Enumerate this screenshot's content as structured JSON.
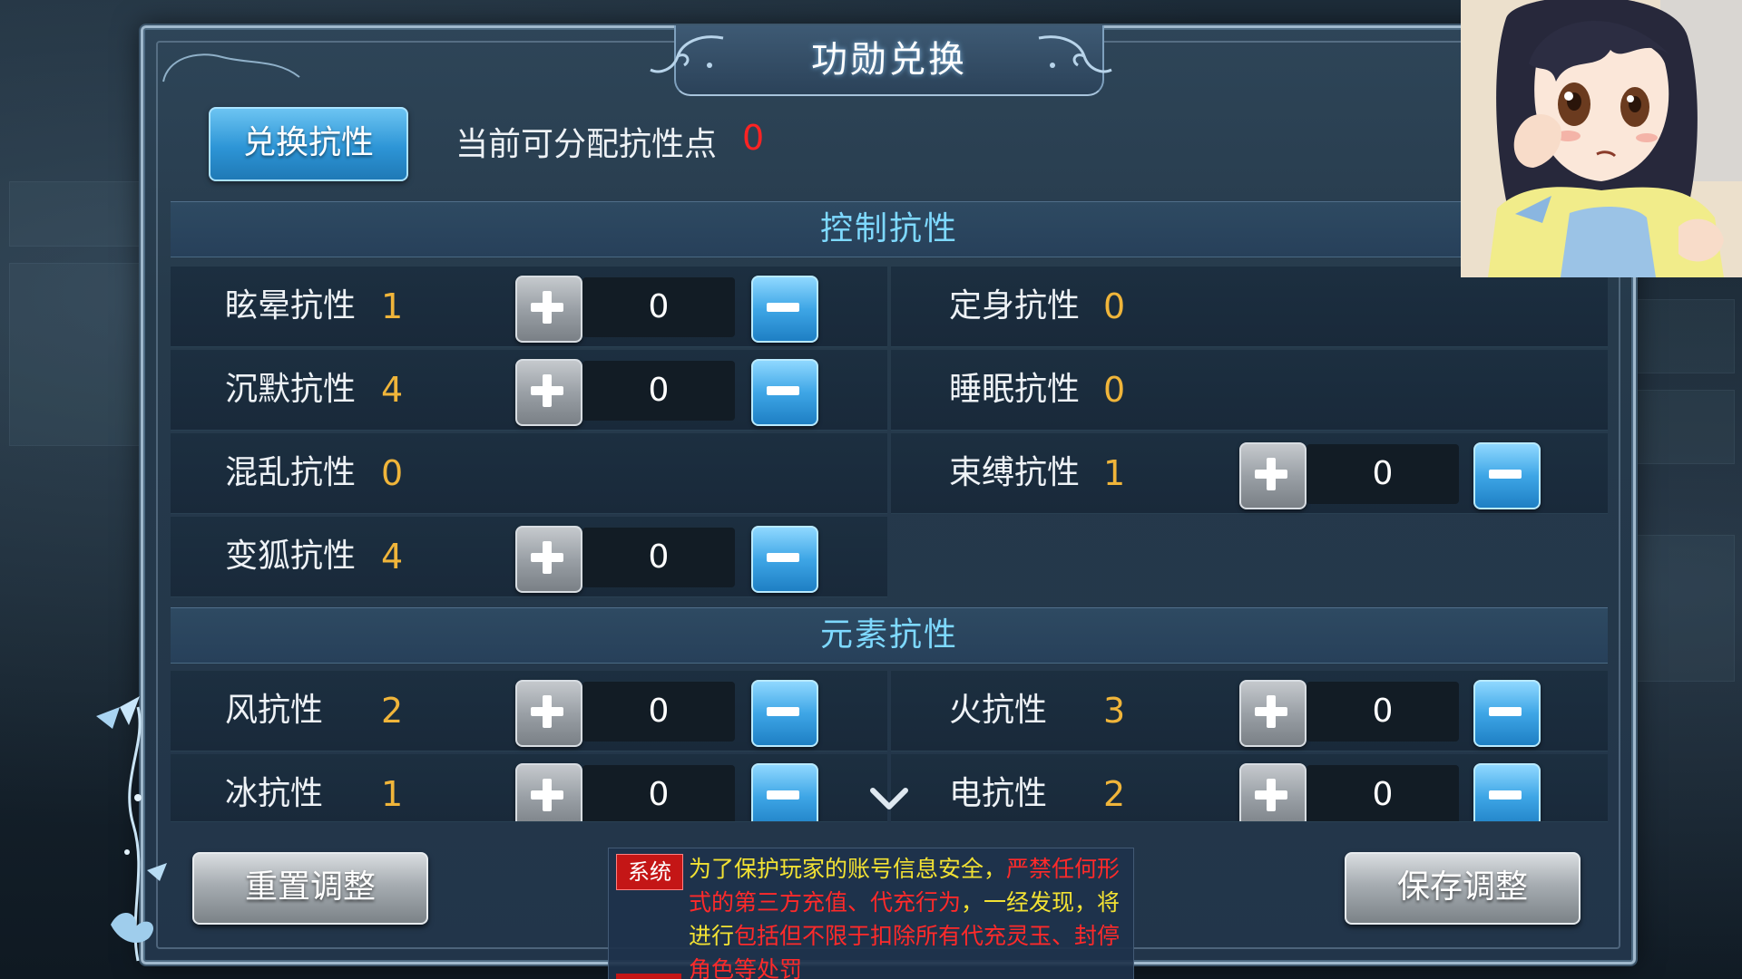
{
  "title": "功勋兑换",
  "top_bar": {
    "exchange_button": "兑换抗性",
    "points_label": "当前可分配抗性点",
    "points_value": "0"
  },
  "sections": {
    "control": "控制抗性",
    "element": "元素抗性"
  },
  "control_resistances": [
    {
      "name": "眩晕抗性",
      "value": "1",
      "allocated": "0",
      "adjustable": true
    },
    {
      "name": "定身抗性",
      "value": "0",
      "adjustable": false
    },
    {
      "name": "沉默抗性",
      "value": "4",
      "allocated": "0",
      "adjustable": true
    },
    {
      "name": "睡眠抗性",
      "value": "0",
      "adjustable": false
    },
    {
      "name": "混乱抗性",
      "value": "0",
      "adjustable": false
    },
    {
      "name": "束缚抗性",
      "value": "1",
      "allocated": "0",
      "adjustable": true
    },
    {
      "name": "变狐抗性",
      "value": "4",
      "allocated": "0",
      "adjustable": true
    }
  ],
  "element_resistances": [
    {
      "name": "风抗性",
      "value": "2",
      "allocated": "0",
      "adjustable": true
    },
    {
      "name": "火抗性",
      "value": "3",
      "allocated": "0",
      "adjustable": true
    },
    {
      "name": "冰抗性",
      "value": "1",
      "allocated": "0",
      "adjustable": true
    },
    {
      "name": "电抗性",
      "value": "2",
      "allocated": "0",
      "adjustable": true
    }
  ],
  "bottom": {
    "reset_button": "重置调整",
    "save_button": "保存调整"
  },
  "notice": {
    "tag": "系统",
    "part1": "为了保护玩家的账号信息安全，",
    "part2_red": "严禁任何形式的第三方充值、代充行为",
    "part3": "，一经发现，将进行",
    "part4_red": "包括但不限于扣除所有代充灵玉、封停角色等处罚"
  },
  "icons": {
    "plus": "plus-icon",
    "minus": "minus-icon",
    "chevron": "chevron-down-icon"
  },
  "colors": {
    "value_gold": "#f0b53a",
    "points_red": "#ff2323",
    "section_cyan": "#7ed9ff",
    "minus_blue": "#3ea6e6"
  }
}
